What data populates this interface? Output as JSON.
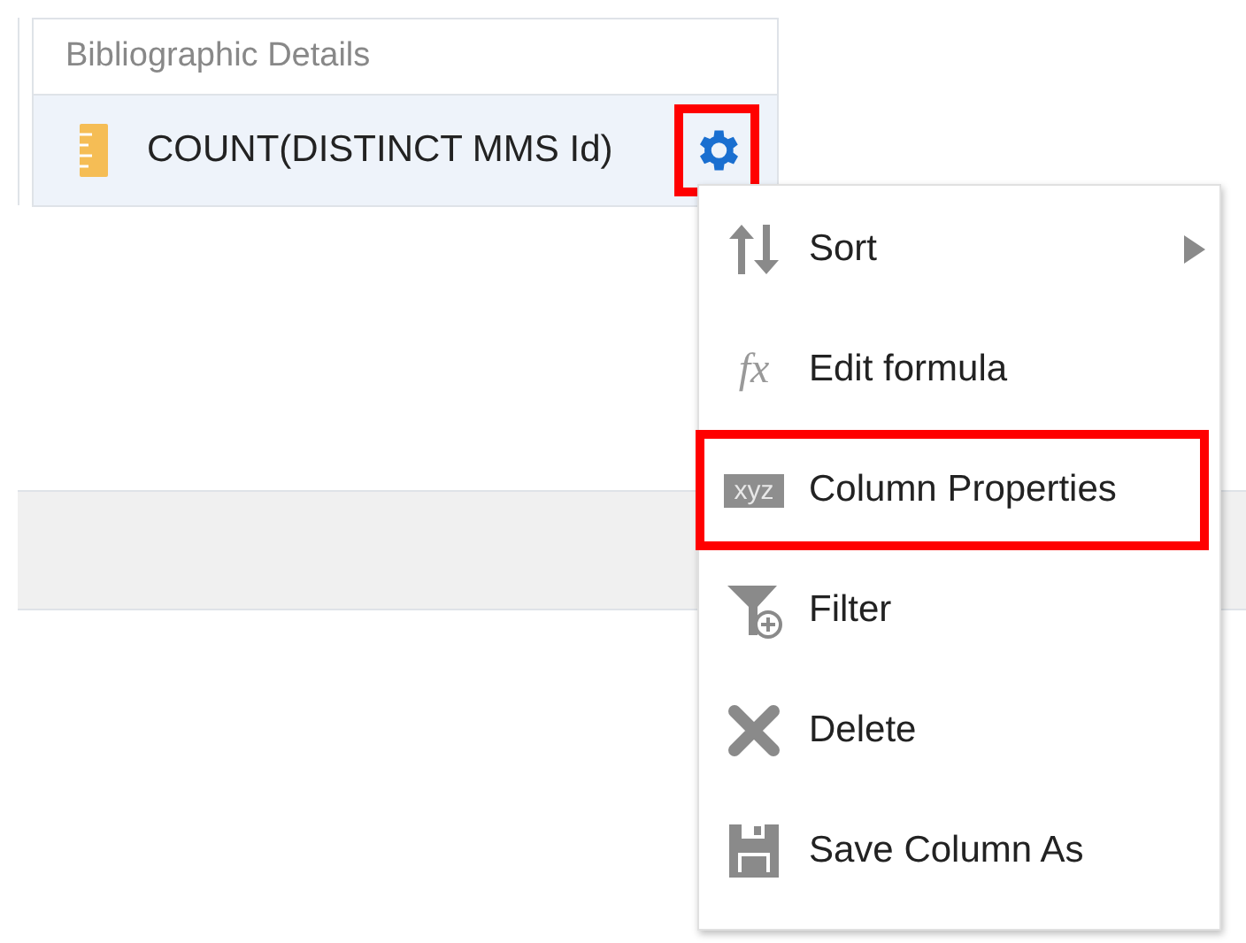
{
  "column_header": {
    "title": "Bibliographic Details"
  },
  "column_item": {
    "label": "COUNT(DISTINCT MMS Id)",
    "settings_highlighted": true
  },
  "menu": [
    {
      "kind": "sort",
      "label": "Sort",
      "submenu": true,
      "highlighted": false
    },
    {
      "kind": "formula",
      "label": "Edit formula",
      "icon_text": "fx",
      "submenu": false,
      "highlighted": false
    },
    {
      "kind": "properties",
      "label": "Column Properties",
      "icon_text": "xyz",
      "submenu": false,
      "highlighted": true
    },
    {
      "kind": "filter",
      "label": "Filter",
      "submenu": false,
      "highlighted": false
    },
    {
      "kind": "delete",
      "label": "Delete",
      "submenu": false,
      "highlighted": false
    },
    {
      "kind": "save",
      "label": "Save Column As",
      "submenu": false,
      "highlighted": false
    }
  ]
}
